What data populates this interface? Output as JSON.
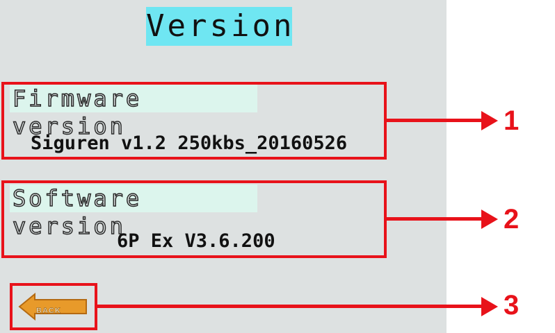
{
  "title": "Version",
  "firmware": {
    "label": "Firmware version",
    "value": "Siguren v1.2 250kbs_20160526"
  },
  "software": {
    "label": "Software version",
    "value": "6P Ex V3.6.200"
  },
  "back_button": {
    "label": "BACK"
  },
  "callouts": [
    "1",
    "2",
    "3"
  ],
  "colors": {
    "screen_background": "#dde1e1",
    "title_highlight": "#6fe6f2",
    "label_highlight": "#dcf5ed",
    "annotation_red": "#e8121a",
    "back_button_orange": "#e89a2a"
  }
}
